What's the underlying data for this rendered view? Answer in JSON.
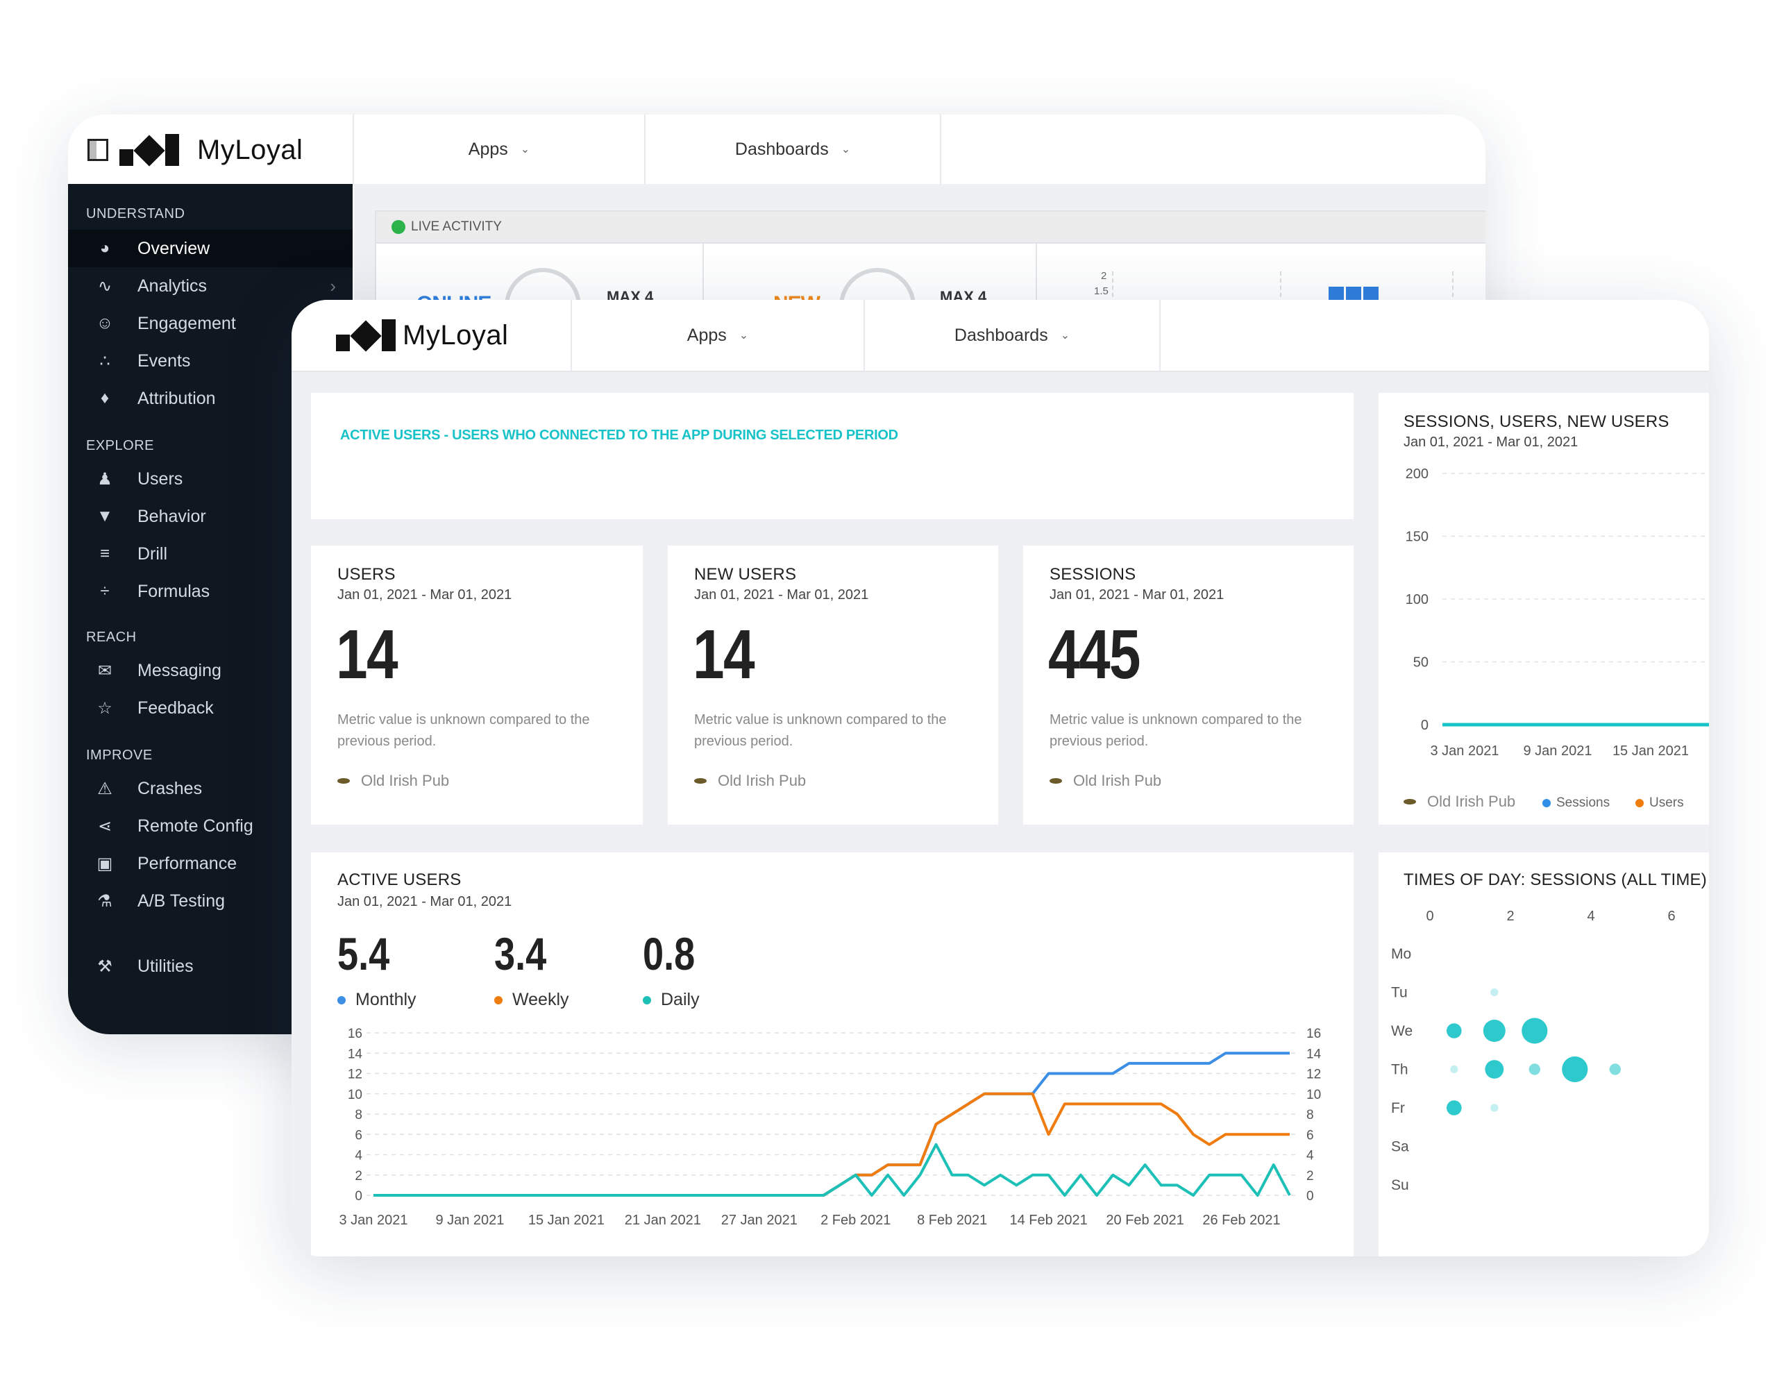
{
  "back": {
    "brand": "MyLoyal",
    "tabs": [
      {
        "label": "Apps"
      },
      {
        "label": "Dashboards"
      }
    ],
    "sidebar": {
      "sections": [
        {
          "title": "UNDERSTAND"
        },
        {
          "title": "EXPLORE"
        },
        {
          "title": "REACH"
        },
        {
          "title": "IMPROVE"
        }
      ],
      "items": [
        {
          "label": "Overview",
          "icon": "gauge-icon"
        },
        {
          "label": "Analytics",
          "icon": "pulse-icon"
        },
        {
          "label": "Engagement",
          "icon": "smile-icon"
        },
        {
          "label": "Events",
          "icon": "events-icon"
        },
        {
          "label": "Attribution",
          "icon": "tag-icon"
        },
        {
          "label": "Users",
          "icon": "users-icon"
        },
        {
          "label": "Behavior",
          "icon": "funnel-icon"
        },
        {
          "label": "Drill",
          "icon": "filter-icon"
        },
        {
          "label": "Formulas",
          "icon": "divide-icon"
        },
        {
          "label": "Messaging",
          "icon": "chat-icon"
        },
        {
          "label": "Feedback",
          "icon": "star-icon"
        },
        {
          "label": "Crashes",
          "icon": "warning-icon"
        },
        {
          "label": "Remote Config",
          "icon": "share-icon"
        },
        {
          "label": "Performance",
          "icon": "chip-icon"
        },
        {
          "label": "A/B Testing",
          "icon": "flask-icon"
        },
        {
          "label": "Utilities",
          "icon": "wrench-icon"
        }
      ]
    },
    "live": {
      "title": "LIVE ACTIVITY",
      "online_label": "ONLINE",
      "online_max": "MAX 4",
      "new_label": "NEW",
      "new_max": "MAX 4",
      "mini_ticks": [
        "2",
        "1.5"
      ],
      "colors": {
        "online": "#2f7fe0",
        "new": "#f08a1c",
        "live": "#2bb34a"
      }
    }
  },
  "front": {
    "brand": "MyLoyal",
    "tabs": [
      {
        "label": "Apps"
      },
      {
        "label": "Dashboards"
      }
    ],
    "banner": "ACTIVE USERS - USERS WHO CONNECTED TO THE APP DURING SELECTED PERIOD",
    "metrics": [
      {
        "title": "USERS",
        "date": "Jan 01, 2021 - Mar 01, 2021",
        "value": "14",
        "note": "Metric value is unknown compared to the previous period.",
        "app": "Old Irish Pub"
      },
      {
        "title": "NEW USERS",
        "date": "Jan 01, 2021 - Mar 01, 2021",
        "value": "14",
        "note": "Metric value is unknown compared to the previous period.",
        "app": "Old Irish Pub"
      },
      {
        "title": "SESSIONS",
        "date": "Jan 01, 2021 - Mar 01, 2021",
        "value": "445",
        "note": "Metric value is unknown compared to the previous period.",
        "app": "Old Irish Pub"
      }
    ],
    "sessions_card": {
      "title": "SESSIONS, USERS, NEW USERS",
      "date": "Jan 01, 2021 - Mar 01, 2021",
      "app": "Old Irish Pub",
      "legend": [
        {
          "name": "Sessions",
          "color": "#2f8fe6"
        },
        {
          "name": "Users",
          "color": "#f07c10"
        }
      ]
    },
    "active_users": {
      "title": "ACTIVE USERS",
      "date": "Jan 01, 2021 - Mar 01, 2021",
      "stats": [
        {
          "value": "5.4",
          "label": "Monthly",
          "color": "#3d8fe6"
        },
        {
          "value": "3.4",
          "label": "Weekly",
          "color": "#f07c10"
        },
        {
          "value": "0.8",
          "label": "Daily",
          "color": "#1cc0b6"
        }
      ]
    },
    "times_card": {
      "title": "TIMES OF DAY: SESSIONS (ALL TIME)"
    }
  },
  "chart_data": [
    {
      "type": "line",
      "title": "",
      "x": [
        "3 Jan 2021",
        "4 Jan 2021",
        "5 Jan 2021",
        "6 Jan 2021",
        "7 Jan 2021",
        "8 Jan 2021",
        "9 Jan 2021",
        "10 Jan 2021",
        "11 Jan 2021",
        "12 Jan 2021",
        "13 Jan 2021",
        "14 Jan 2021",
        "15 Jan 2021",
        "16 Jan 2021",
        "17 Jan 2021",
        "18 Jan 2021",
        "19 Jan 2021",
        "20 Jan 2021",
        "21 Jan 2021",
        "22 Jan 2021",
        "23 Jan 2021",
        "24 Jan 2021",
        "25 Jan 2021",
        "26 Jan 2021",
        "27 Jan 2021",
        "28 Jan 2021",
        "29 Jan 2021",
        "30 Jan 2021",
        "31 Jan 2021",
        "1 Feb 2021",
        "2 Feb 2021",
        "3 Feb 2021",
        "4 Feb 2021",
        "5 Feb 2021",
        "6 Feb 2021",
        "7 Feb 2021",
        "8 Feb 2021",
        "9 Feb 2021",
        "10 Feb 2021",
        "11 Feb 2021",
        "12 Feb 2021",
        "13 Feb 2021",
        "14 Feb 2021",
        "15 Feb 2021",
        "16 Feb 2021",
        "17 Feb 2021",
        "18 Feb 2021",
        "19 Feb 2021",
        "20 Feb 2021",
        "21 Feb 2021",
        "22 Feb 2021",
        "23 Feb 2021",
        "24 Feb 2021",
        "25 Feb 2021",
        "26 Feb 2021",
        "27 Feb 2021",
        "28 Feb 2021",
        "1 Mar 2021"
      ],
      "x_ticks": [
        "3 Jan 2021",
        "9 Jan 2021",
        "15 Jan 2021",
        "21 Jan 2021",
        "27 Jan 2021",
        "2 Feb 2021",
        "8 Feb 2021",
        "14 Feb 2021",
        "20 Feb 2021",
        "26 Feb 2021"
      ],
      "y_ticks": [
        0,
        2,
        4,
        6,
        8,
        10,
        12,
        14,
        16
      ],
      "ylim": [
        0,
        16
      ],
      "grid": true,
      "series": [
        {
          "name": "Monthly",
          "color": "#3d8fe6",
          "values": [
            0,
            0,
            0,
            0,
            0,
            0,
            0,
            0,
            0,
            0,
            0,
            0,
            0,
            0,
            0,
            0,
            0,
            0,
            0,
            0,
            0,
            0,
            0,
            0,
            0,
            0,
            0,
            0,
            0,
            1,
            2,
            2,
            3,
            3,
            3,
            7,
            8,
            9,
            10,
            10,
            10,
            10,
            12,
            12,
            12,
            12,
            12,
            13,
            13,
            13,
            13,
            13,
            13,
            14,
            14,
            14,
            14,
            14
          ]
        },
        {
          "name": "Weekly",
          "color": "#f07c10",
          "values": [
            0,
            0,
            0,
            0,
            0,
            0,
            0,
            0,
            0,
            0,
            0,
            0,
            0,
            0,
            0,
            0,
            0,
            0,
            0,
            0,
            0,
            0,
            0,
            0,
            0,
            0,
            0,
            0,
            0,
            1,
            2,
            2,
            3,
            3,
            3,
            7,
            8,
            9,
            10,
            10,
            10,
            10,
            6,
            9,
            9,
            9,
            9,
            9,
            9,
            9,
            8,
            6,
            5,
            6,
            6,
            6,
            6,
            6
          ]
        },
        {
          "name": "Daily",
          "color": "#1cc0b6",
          "values": [
            0,
            0,
            0,
            0,
            0,
            0,
            0,
            0,
            0,
            0,
            0,
            0,
            0,
            0,
            0,
            0,
            0,
            0,
            0,
            0,
            0,
            0,
            0,
            0,
            0,
            0,
            0,
            0,
            0,
            1,
            2,
            0,
            2,
            0,
            2,
            5,
            2,
            2,
            1,
            2,
            1,
            2,
            2,
            0,
            2,
            0,
            2,
            1,
            3,
            1,
            1,
            0,
            2,
            2,
            2,
            0,
            3,
            0
          ]
        }
      ]
    },
    {
      "type": "line",
      "title": "SESSIONS, USERS, NEW USERS",
      "x_ticks": [
        "3 Jan 2021",
        "9 Jan 2021",
        "15 Jan 2021"
      ],
      "y_ticks": [
        0,
        50,
        100,
        150,
        200
      ],
      "ylim": [
        0,
        200
      ],
      "grid": true,
      "series": [
        {
          "name": "Sessions",
          "color": "#2f8fe6",
          "values": [
            0,
            0,
            0,
            0,
            0,
            0,
            0,
            0,
            0,
            0,
            0,
            0,
            0,
            0,
            0,
            0,
            0,
            0
          ]
        },
        {
          "name": "Users",
          "color": "#f07c10",
          "values": [
            0,
            0,
            0,
            0,
            0,
            0,
            0,
            0,
            0,
            0,
            0,
            0,
            0,
            0,
            0,
            0,
            0,
            0
          ]
        }
      ]
    },
    {
      "type": "scatter",
      "title": "TIMES OF DAY: SESSIONS (ALL TIME)",
      "x_ticks": [
        0,
        2,
        4,
        6
      ],
      "categories": [
        "Mo",
        "Tu",
        "We",
        "Th",
        "Fr",
        "Sa",
        "Su"
      ],
      "points": [
        {
          "day": "Tu",
          "hour": 1.6,
          "size": 1
        },
        {
          "day": "We",
          "hour": 0.6,
          "size": 3
        },
        {
          "day": "We",
          "hour": 1.6,
          "size": 5
        },
        {
          "day": "We",
          "hour": 2.6,
          "size": 6
        },
        {
          "day": "Th",
          "hour": 0.6,
          "size": 1
        },
        {
          "day": "Th",
          "hour": 1.6,
          "size": 4
        },
        {
          "day": "Th",
          "hour": 2.6,
          "size": 2
        },
        {
          "day": "Th",
          "hour": 3.6,
          "size": 6
        },
        {
          "day": "Th",
          "hour": 4.6,
          "size": 2
        },
        {
          "day": "Fr",
          "hour": 0.6,
          "size": 3
        },
        {
          "day": "Fr",
          "hour": 1.6,
          "size": 1
        }
      ],
      "color": "#17c3c8"
    }
  ]
}
